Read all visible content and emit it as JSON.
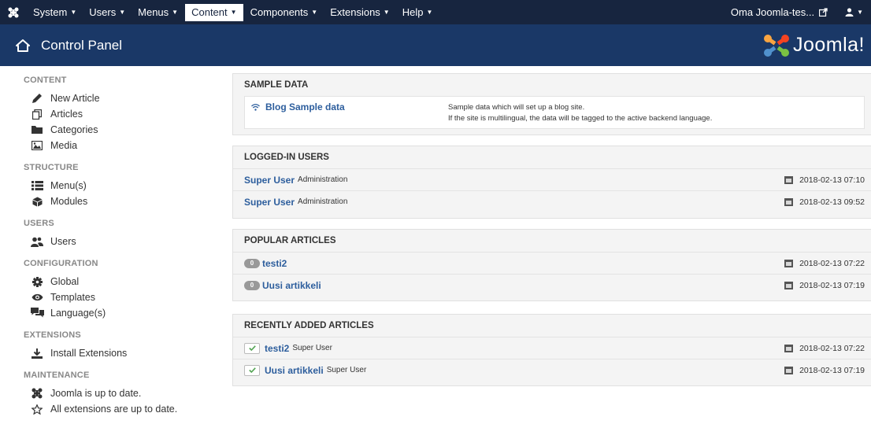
{
  "topnav": {
    "menus": [
      {
        "label": "System",
        "active": false
      },
      {
        "label": "Users",
        "active": false
      },
      {
        "label": "Menus",
        "active": false
      },
      {
        "label": "Content",
        "active": true
      },
      {
        "label": "Components",
        "active": false
      },
      {
        "label": "Extensions",
        "active": false
      },
      {
        "label": "Help",
        "active": false
      }
    ],
    "site_link": "Oma Joomla-tes...",
    "user_icon": "user-icon"
  },
  "header": {
    "title": "Control Panel",
    "brand": "Joomla!"
  },
  "sidebar": {
    "sections": [
      {
        "title": "CONTENT",
        "items": [
          {
            "label": "New Article",
            "icon": "pencil-icon"
          },
          {
            "label": "Articles",
            "icon": "stack-icon"
          },
          {
            "label": "Categories",
            "icon": "folder-icon"
          },
          {
            "label": "Media",
            "icon": "image-icon"
          }
        ]
      },
      {
        "title": "STRUCTURE",
        "items": [
          {
            "label": "Menu(s)",
            "icon": "list-icon"
          },
          {
            "label": "Modules",
            "icon": "cube-icon"
          }
        ]
      },
      {
        "title": "USERS",
        "items": [
          {
            "label": "Users",
            "icon": "users-icon"
          }
        ]
      },
      {
        "title": "CONFIGURATION",
        "items": [
          {
            "label": "Global",
            "icon": "cog-icon"
          },
          {
            "label": "Templates",
            "icon": "eye-icon"
          },
          {
            "label": "Language(s)",
            "icon": "comments-icon"
          }
        ]
      },
      {
        "title": "EXTENSIONS",
        "items": [
          {
            "label": "Install Extensions",
            "icon": "upload-icon"
          }
        ]
      },
      {
        "title": "MAINTENANCE",
        "items": [
          {
            "label": "Joomla is up to date.",
            "icon": "joomla-icon"
          },
          {
            "label": "All extensions are up to date.",
            "icon": "star-icon"
          }
        ]
      }
    ]
  },
  "sample_data": {
    "title": "SAMPLE DATA",
    "link": "Blog Sample data",
    "desc_line1": "Sample data which will set up a blog site.",
    "desc_line2": "If the site is multilingual, the data will be tagged to the active backend language."
  },
  "logged_in": {
    "title": "LOGGED-IN USERS",
    "rows": [
      {
        "name": "Super User",
        "where": "Administration",
        "date": "2018-02-13 07:10"
      },
      {
        "name": "Super User",
        "where": "Administration",
        "date": "2018-02-13 09:52"
      }
    ]
  },
  "popular": {
    "title": "POPULAR ARTICLES",
    "rows": [
      {
        "hits": "0",
        "title": "testi2",
        "date": "2018-02-13 07:22"
      },
      {
        "hits": "0",
        "title": "Uusi artikkeli",
        "date": "2018-02-13 07:19"
      }
    ]
  },
  "recent": {
    "title": "RECENTLY ADDED ARTICLES",
    "rows": [
      {
        "title": "testi2",
        "author": "Super User",
        "date": "2018-02-13 07:22"
      },
      {
        "title": "Uusi artikkeli",
        "author": "Super User",
        "date": "2018-02-13 07:19"
      }
    ]
  }
}
